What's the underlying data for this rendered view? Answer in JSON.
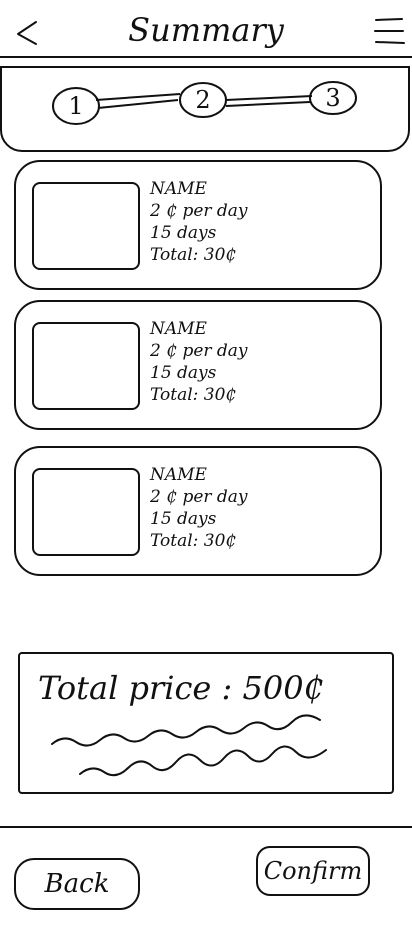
{
  "header": {
    "title": "Summary",
    "back_icon": "chevron-left-icon",
    "menu_icon": "hamburger-menu-icon"
  },
  "stepper": {
    "steps": [
      "1",
      "2",
      "3"
    ]
  },
  "items": [
    {
      "name": "NAME",
      "price": "2 ₵ per day",
      "duration": "15 days",
      "total": "Total: 30₵"
    },
    {
      "name": "NAME",
      "price": "2 ₵ per day",
      "duration": "15 days",
      "total": "Total: 30₵"
    },
    {
      "name": "NAME",
      "price": "2 ₵ per day",
      "duration": "15 days",
      "total": "Total: 30₵"
    }
  ],
  "summary": {
    "total_label": "Total price : 500₵"
  },
  "footer": {
    "back_label": "Back",
    "confirm_label": "Confirm"
  }
}
